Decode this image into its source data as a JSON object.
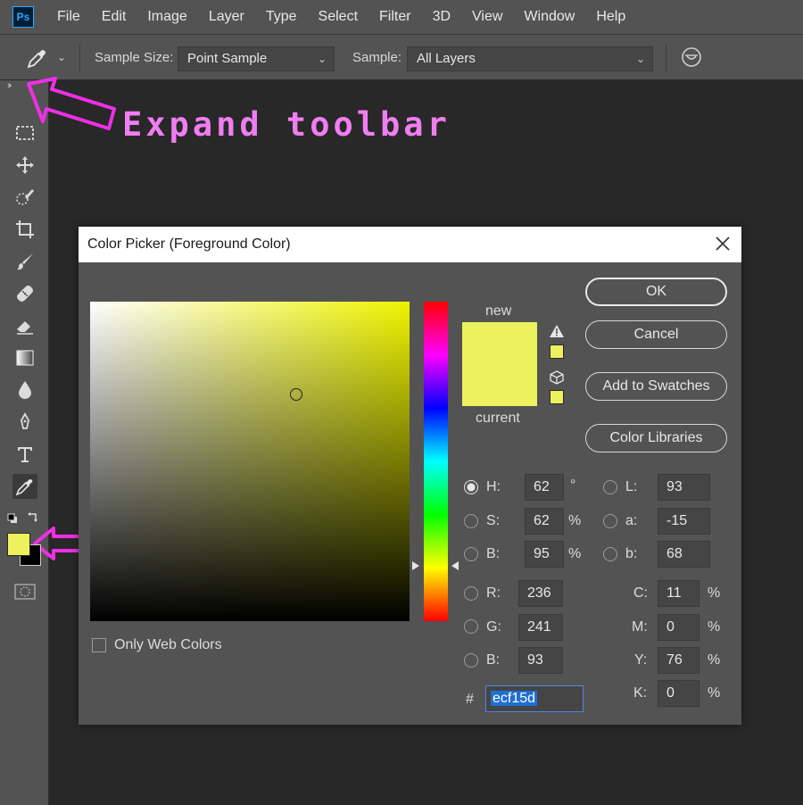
{
  "menubar": {
    "logo": "Ps",
    "items": [
      "File",
      "Edit",
      "Image",
      "Layer",
      "Type",
      "Select",
      "Filter",
      "3D",
      "View",
      "Window",
      "Help"
    ]
  },
  "options": {
    "sample_size_label": "Sample Size:",
    "sample_size_value": "Point Sample",
    "sample_label": "Sample:",
    "sample_value": "All Layers"
  },
  "toolbar": {
    "expand_glyph": "››",
    "foreground_color": "#ecf15d",
    "background_color": "#000000"
  },
  "annotation": {
    "text": "Expand toolbar",
    "color": "#f07ef2"
  },
  "dialog": {
    "title": "Color Picker (Foreground Color)",
    "new_label": "new",
    "current_label": "current",
    "buttons": {
      "ok": "OK",
      "cancel": "Cancel",
      "add_swatches": "Add to Swatches",
      "color_libraries": "Color Libraries"
    },
    "hsb": {
      "h_label": "H:",
      "h_value": "62",
      "h_unit": "°",
      "s_label": "S:",
      "s_value": "62",
      "s_unit": "%",
      "b_label": "B:",
      "b_value": "95",
      "b_unit": "%"
    },
    "lab": {
      "l_label": "L:",
      "l_value": "93",
      "a_label": "a:",
      "a_value": "-15",
      "b_label": "b:",
      "b_value": "68"
    },
    "rgb": {
      "r_label": "R:",
      "r_value": "236",
      "g_label": "G:",
      "g_value": "241",
      "b_label": "B:",
      "b_value": "93"
    },
    "cmyk": {
      "c_label": "C:",
      "c_value": "11",
      "m_label": "M:",
      "m_value": "0",
      "y_label": "Y:",
      "y_value": "76",
      "k_label": "K:",
      "k_value": "0",
      "unit": "%"
    },
    "hex_label": "#",
    "hex_value": "ecf15d",
    "only_web_colors": "Only Web Colors",
    "selected_color": "#ecf15d"
  }
}
